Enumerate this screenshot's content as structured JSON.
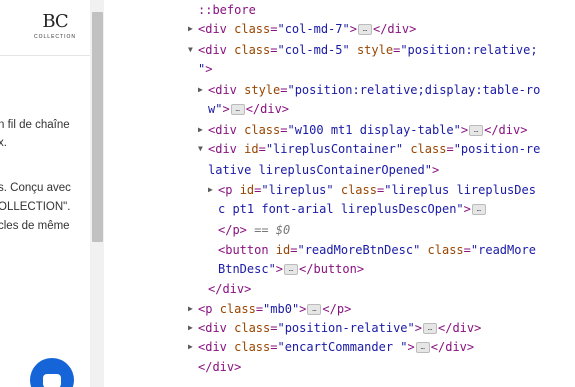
{
  "page": {
    "logo_mark": "BC",
    "logo_sub": "COLLECTION",
    "text_lines": [
      "n fil de chaîne",
      "x.",
      "s. Conçu avec",
      "OLLECTION\".",
      "cles de même"
    ]
  },
  "devtools": {
    "lines": [
      {
        "indent": 0,
        "tri": "",
        "parts": [
          {
            "c": "pseudo",
            "t": "::before"
          }
        ]
      },
      {
        "indent": 0,
        "tri": "right",
        "parts": [
          {
            "c": "tag",
            "t": "<div "
          },
          {
            "c": "attr",
            "t": "class"
          },
          {
            "c": "eq",
            "t": "="
          },
          {
            "c": "val",
            "t": "\"col-md-7\""
          },
          {
            "c": "tag",
            "t": ">"
          },
          {
            "c": "ell",
            "t": "…"
          },
          {
            "c": "tag",
            "t": "</div>"
          }
        ]
      },
      {
        "indent": 0,
        "tri": "down",
        "parts": [
          {
            "c": "tag",
            "t": "<div "
          },
          {
            "c": "attr",
            "t": "class"
          },
          {
            "c": "eq",
            "t": "="
          },
          {
            "c": "val",
            "t": "\"col-md-5\""
          },
          {
            "c": "attr",
            "t": " style"
          },
          {
            "c": "eq",
            "t": "="
          },
          {
            "c": "val",
            "t": "\"position:relative;"
          }
        ]
      },
      {
        "indent": 0,
        "tri": "",
        "parts": [
          {
            "c": "val",
            "t": "\""
          },
          {
            "c": "tag",
            "t": ">"
          }
        ]
      },
      {
        "indent": 1,
        "tri": "right",
        "parts": [
          {
            "c": "tag",
            "t": "<div "
          },
          {
            "c": "attr",
            "t": "style"
          },
          {
            "c": "eq",
            "t": "="
          },
          {
            "c": "val",
            "t": "\"position:relative;display:table-ro"
          }
        ]
      },
      {
        "indent": 1,
        "tri": "",
        "parts": [
          {
            "c": "val",
            "t": "w\""
          },
          {
            "c": "tag",
            "t": ">"
          },
          {
            "c": "ell",
            "t": "…"
          },
          {
            "c": "tag",
            "t": "</div>"
          }
        ]
      },
      {
        "indent": 1,
        "tri": "right",
        "parts": [
          {
            "c": "tag",
            "t": "<div "
          },
          {
            "c": "attr",
            "t": "class"
          },
          {
            "c": "eq",
            "t": "="
          },
          {
            "c": "val",
            "t": "\"w100 mt1 display-table\""
          },
          {
            "c": "tag",
            "t": ">"
          },
          {
            "c": "ell",
            "t": "…"
          },
          {
            "c": "tag",
            "t": "</div>"
          }
        ]
      },
      {
        "indent": 1,
        "tri": "down",
        "parts": [
          {
            "c": "tag",
            "t": "<div "
          },
          {
            "c": "attr",
            "t": "id"
          },
          {
            "c": "eq",
            "t": "="
          },
          {
            "c": "val",
            "t": "\"lireplusContainer\""
          },
          {
            "c": "attr",
            "t": " class"
          },
          {
            "c": "eq",
            "t": "="
          },
          {
            "c": "val",
            "t": "\"position-re"
          }
        ]
      },
      {
        "indent": 1,
        "tri": "",
        "parts": [
          {
            "c": "val",
            "t": "lative lireplusContainerOpened\""
          },
          {
            "c": "tag",
            "t": ">"
          }
        ]
      },
      {
        "indent": 2,
        "tri": "right",
        "parts": [
          {
            "c": "tag",
            "t": "<p "
          },
          {
            "c": "attr",
            "t": "id"
          },
          {
            "c": "eq",
            "t": "="
          },
          {
            "c": "val",
            "t": "\"lireplus\""
          },
          {
            "c": "attr",
            "t": " class"
          },
          {
            "c": "eq",
            "t": "="
          },
          {
            "c": "val",
            "t": "\"lireplus lireplusDes"
          }
        ]
      },
      {
        "indent": 2,
        "tri": "",
        "parts": [
          {
            "c": "val",
            "t": "c pt1 font-arial lireplusDescOpen\""
          },
          {
            "c": "tag",
            "t": ">"
          },
          {
            "c": "ell",
            "t": "…"
          }
        ]
      },
      {
        "indent": 2,
        "tri": "",
        "parts": [
          {
            "c": "tag",
            "t": "</p>"
          },
          {
            "c": "dim",
            "t": " == $0"
          }
        ]
      },
      {
        "indent": 2,
        "tri": "",
        "parts": [
          {
            "c": "tag",
            "t": "<button "
          },
          {
            "c": "attr",
            "t": "id"
          },
          {
            "c": "eq",
            "t": "="
          },
          {
            "c": "val",
            "t": "\"readMoreBtnDesc\""
          },
          {
            "c": "attr",
            "t": " class"
          },
          {
            "c": "eq",
            "t": "="
          },
          {
            "c": "val",
            "t": "\"readMore"
          }
        ]
      },
      {
        "indent": 2,
        "tri": "",
        "parts": [
          {
            "c": "val",
            "t": "BtnDesc\""
          },
          {
            "c": "tag",
            "t": ">"
          },
          {
            "c": "ell",
            "t": "…"
          },
          {
            "c": "tag",
            "t": "</button>"
          }
        ]
      },
      {
        "indent": 1,
        "tri": "",
        "parts": [
          {
            "c": "tag",
            "t": "</div>"
          }
        ]
      },
      {
        "indent": 0,
        "tri": "right",
        "parts": [
          {
            "c": "tag",
            "t": "<p "
          },
          {
            "c": "attr",
            "t": "class"
          },
          {
            "c": "eq",
            "t": "="
          },
          {
            "c": "val",
            "t": "\"mb0\""
          },
          {
            "c": "tag",
            "t": ">"
          },
          {
            "c": "ell",
            "t": "…"
          },
          {
            "c": "tag",
            "t": "</p>"
          }
        ]
      },
      {
        "indent": 0,
        "tri": "right",
        "parts": [
          {
            "c": "tag",
            "t": "<div "
          },
          {
            "c": "attr",
            "t": "class"
          },
          {
            "c": "eq",
            "t": "="
          },
          {
            "c": "val",
            "t": "\"position-relative\""
          },
          {
            "c": "tag",
            "t": ">"
          },
          {
            "c": "ell",
            "t": "…"
          },
          {
            "c": "tag",
            "t": "</div>"
          }
        ]
      },
      {
        "indent": 0,
        "tri": "right",
        "parts": [
          {
            "c": "tag",
            "t": "<div "
          },
          {
            "c": "attr",
            "t": "class"
          },
          {
            "c": "eq",
            "t": "="
          },
          {
            "c": "val",
            "t": "\"encartCommander \""
          },
          {
            "c": "tag",
            "t": ">"
          },
          {
            "c": "ell",
            "t": "…"
          },
          {
            "c": "tag",
            "t": "</div>"
          }
        ]
      },
      {
        "indent": 0,
        "tri": "",
        "parts": [
          {
            "c": "tag",
            "t": "</div>"
          }
        ]
      }
    ]
  }
}
